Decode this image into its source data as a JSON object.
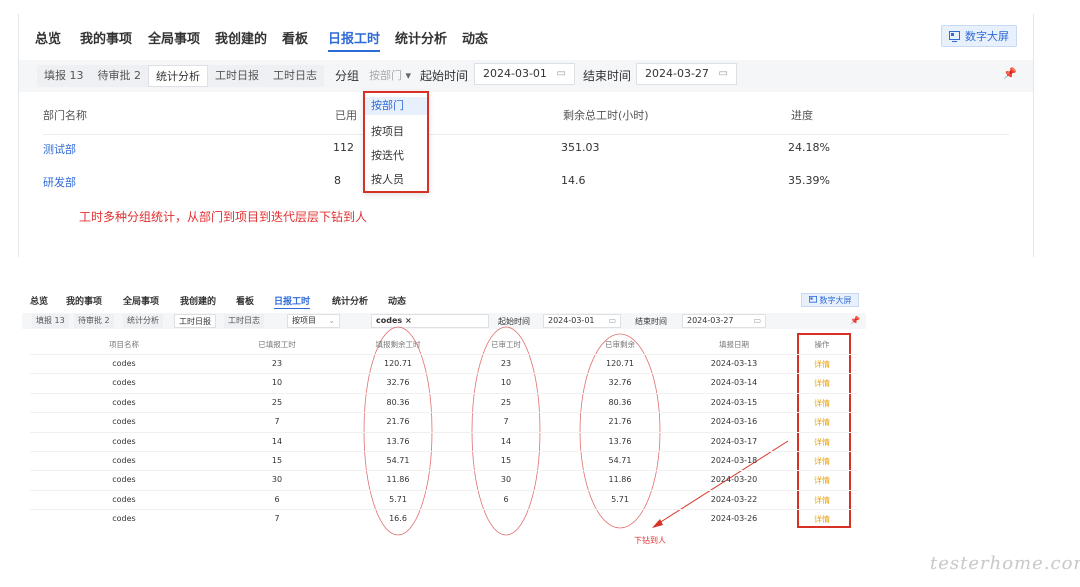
{
  "panel1": {
    "nav": [
      "总览",
      "我的事项",
      "全局事项",
      "我创建的",
      "看板",
      "日报工时",
      "统计分析",
      "动态"
    ],
    "big_screen": "数字大屏",
    "tabs": [
      "填报 13",
      "待审批 2",
      "统计分析",
      "工时日报",
      "工时日志"
    ],
    "group_label": "分组",
    "group_select": "按部门",
    "start_label": "起始时间",
    "start_date": "2024-03-01",
    "end_label": "结束时间",
    "end_date": "2024-03-27",
    "columns": [
      "部门名称",
      "已用",
      "剩余总工时(小时)",
      "进度"
    ],
    "rows": [
      {
        "name": "测试部",
        "used": "112",
        "remaining": "351.03",
        "progress": "24.18%"
      },
      {
        "name": "研发部",
        "used": "8",
        "remaining": "14.6",
        "progress": "35.39%"
      }
    ],
    "dropdown": [
      "按部门",
      "按项目",
      "按迭代",
      "按人员"
    ],
    "annotation": "工时多种分组统计，从部门到项目到迭代层层下钻到人"
  },
  "panel2": {
    "nav": [
      "总览",
      "我的事项",
      "全局事项",
      "我创建的",
      "看板",
      "日报工时",
      "统计分析",
      "动态"
    ],
    "big_screen": "数字大屏",
    "tabs": [
      "填报 13",
      "待审批 2",
      "统计分析",
      "工时日报",
      "工时日志"
    ],
    "group_select": "按项目",
    "project_tag": "codes ×",
    "start_label": "起始时间",
    "start_date": "2024-03-01",
    "end_label": "结束时间",
    "end_date": "2024-03-27",
    "columns": [
      "项目名称",
      "已填报工时",
      "填报剩余工时",
      "已审工时",
      "已审剩余",
      "填报日期",
      "操作"
    ],
    "rows": [
      [
        "codes",
        "23",
        "120.71",
        "23",
        "120.71",
        "2024-03-13",
        "详情"
      ],
      [
        "codes",
        "10",
        "32.76",
        "10",
        "32.76",
        "2024-03-14",
        "详情"
      ],
      [
        "codes",
        "25",
        "80.36",
        "25",
        "80.36",
        "2024-03-15",
        "详情"
      ],
      [
        "codes",
        "7",
        "21.76",
        "7",
        "21.76",
        "2024-03-16",
        "详情"
      ],
      [
        "codes",
        "14",
        "13.76",
        "14",
        "13.76",
        "2024-03-17",
        "详情"
      ],
      [
        "codes",
        "15",
        "54.71",
        "15",
        "54.71",
        "2024-03-18",
        "详情"
      ],
      [
        "codes",
        "30",
        "11.86",
        "30",
        "11.86",
        "2024-03-20",
        "详情"
      ],
      [
        "codes",
        "6",
        "5.71",
        "6",
        "5.71",
        "2024-03-22",
        "详情"
      ],
      [
        "codes",
        "7",
        "16.6",
        "",
        "",
        "2024-03-26",
        "详情"
      ]
    ],
    "annotation": "下钻到人"
  },
  "watermark": "testerhome.com",
  "colors": {
    "accent": "#2f6bd7",
    "annotation_red": "#d93025",
    "detail_link": "#e8a012"
  }
}
